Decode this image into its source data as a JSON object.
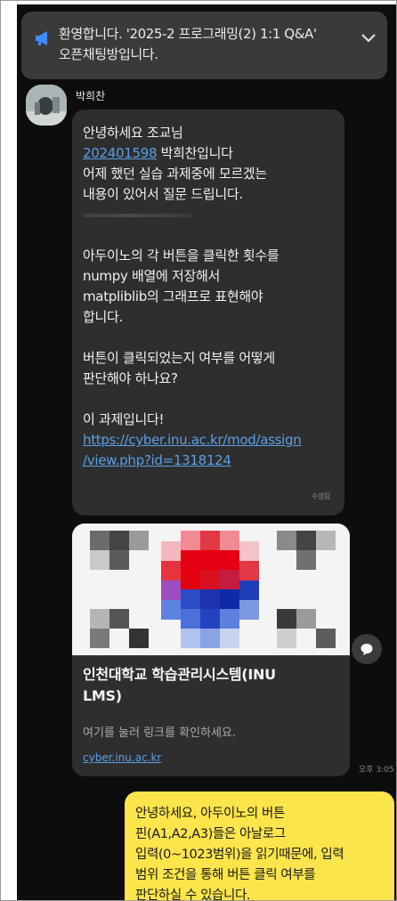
{
  "notice": {
    "icon": "megaphone-icon",
    "text_line1": "환영합니다. '2025-2 프로그래밍(2) 1:1 Q&A'",
    "text_line2": "오픈채팅방입니다.",
    "expand_icon": "chevron-down-icon"
  },
  "message": {
    "sender": "박희찬",
    "lines": {
      "l1": "안녕하세요 조교님",
      "student_id": "202401598",
      "l2_rest": " 박희찬입니다",
      "l3": "어제 했던 실습 과제중에 모르겠는",
      "l4": "내용이 있어서 질문 드립니다.",
      "l5": "아두이노의 각 버튼을 클릭한 횟수를",
      "l6": "numpy 배열에 저장해서",
      "l7": "matpliblib의 그래프로 표현해야",
      "l8": "합니다.",
      "l9": "버튼이 클릭되었는지 여부를 어떻게",
      "l10": "판단해야 하나요?",
      "l11": "이 과제입니다!",
      "link1": "https://cyber.inu.ac.kr/mod/assign",
      "link2": "/view.php?id=1318124"
    },
    "edited_label": "수정됨"
  },
  "link_preview": {
    "title_line1": "인천대학교 학습관리시스템(INU",
    "title_line2": "LMS)",
    "description": "여기를 눌러 링크를 확인하세요.",
    "domain": "cyber.inu.ac.kr",
    "time": "오후 3:05"
  },
  "reply": {
    "lines": [
      "안녕하세요, 아두이노의 버튼",
      "핀(A1,A2,A3)들은 아날로그",
      "입력(0~1023범위)을 읽기때문에, 입력",
      "범위 조건을 통해 버튼 클릭 여부를",
      "판단하실 수 있습니다."
    ]
  },
  "colors": {
    "background": "#0d0d0d",
    "bubble": "#2e2e2e",
    "reply_bubble": "#fbe54a",
    "link": "#5a9fe8",
    "megaphone": "#3f8cff"
  }
}
